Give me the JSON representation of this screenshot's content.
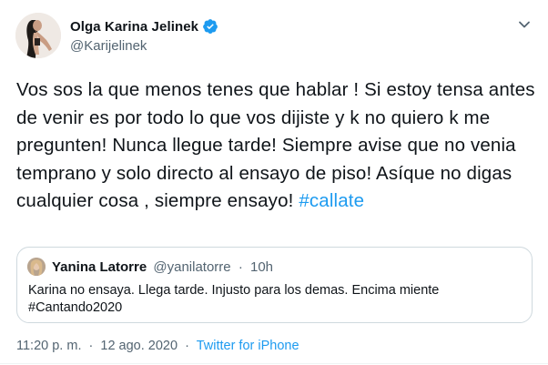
{
  "author": {
    "display_name": "Olga Karina Jelinek",
    "handle": "@Karijelinek",
    "verified": true,
    "verified_icon": "verified-badge-icon"
  },
  "menu_icon": "chevron-down-icon",
  "tweet": {
    "text": "Vos sos la que menos tenes que hablar ! Si estoy tensa antes de venir es por todo lo que vos dijiste y k no quiero k me pregunten! Nunca llegue tarde! Siempre avise que no venia temprano y solo directo al ensayo de piso! Asíque no digas cualquier cosa , siempre ensayo!",
    "hashtag": "#callate"
  },
  "quoted_tweet": {
    "display_name": "Yanina Latorre",
    "handle": "@yanilatorre",
    "separator": "·",
    "time": "10h",
    "text_line1": "Karina no ensaya. Llega tarde. Injusto para los demas. Encima miente",
    "text_line2": "#Cantando2020"
  },
  "meta": {
    "time": "11:20 p. m.",
    "separator": "·",
    "date": "12 ago. 2020",
    "source": "Twitter for iPhone"
  },
  "colors": {
    "link": "#1d9bf0",
    "secondary_text": "#536471",
    "border": "#cfd9de"
  }
}
